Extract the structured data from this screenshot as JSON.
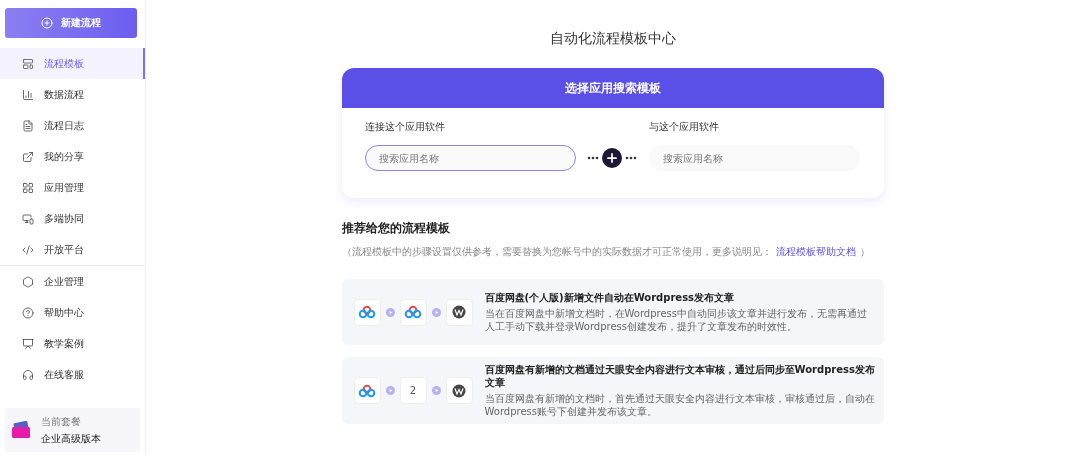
{
  "sidebar": {
    "new_button": "新建流程",
    "items": [
      {
        "label": "流程模板",
        "selected": true
      },
      {
        "label": "数据流程",
        "selected": false
      },
      {
        "label": "流程日志",
        "selected": false
      },
      {
        "label": "我的分享",
        "selected": false
      },
      {
        "label": "应用管理",
        "selected": false
      },
      {
        "label": "多端协同",
        "selected": false
      },
      {
        "label": "开放平台",
        "selected": false
      },
      {
        "label": "企业管理",
        "selected": false
      },
      {
        "label": "帮助中心",
        "selected": false
      },
      {
        "label": "教学案例",
        "selected": false
      },
      {
        "label": "在线客服",
        "selected": false
      }
    ],
    "plan": {
      "label": "当前套餐",
      "value": "企业高级版本"
    }
  },
  "page_title": "自动化流程模板中心",
  "search_card": {
    "title": "选择应用搜索模板",
    "left": {
      "label": "连接这个应用软件",
      "placeholder": "搜索应用名称"
    },
    "right": {
      "label": "与这个应用软件",
      "placeholder": "搜索应用名称"
    }
  },
  "recommend": {
    "title": "推荐给您的流程模板",
    "note_before": "（流程模板中的步骤设置仅供参考，需要替换为您帐号中的实际数据才可正常使用，更多说明见：",
    "link": "流程模板帮助文档",
    "note_after": "）",
    "templates": [
      {
        "steps": [
          {
            "kind": "baidu"
          },
          {
            "kind": "baidu"
          },
          {
            "kind": "wordpress"
          }
        ],
        "title": "百度网盘(个人版)新增文件自动在Wordpress发布文章",
        "description": "当在百度网盘中新增文档时，在Wordpress中自动同步该文章并进行发布，无需再通过人工手动下载并登录Wordpress创建发布，提升了文章发布的时效性。"
      },
      {
        "steps": [
          {
            "kind": "baidu"
          },
          {
            "kind": "number",
            "text": "2"
          },
          {
            "kind": "wordpress"
          }
        ],
        "title": "百度网盘有新增的文档通过天眼安全内容进行文本审核，通过后同步至Wordpress发布文章",
        "description": "当百度网盘有新增的文档时，首先通过天眼安全内容进行文本审核，审核通过后，自动在Wordpress账号下创建并发布该文章。"
      }
    ]
  }
}
